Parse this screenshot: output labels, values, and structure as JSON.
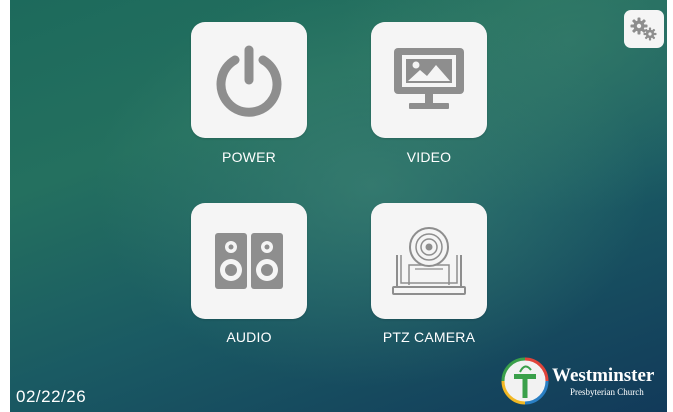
{
  "tiles": [
    {
      "label": "POWER",
      "icon": "power-icon"
    },
    {
      "label": "VIDEO",
      "icon": "monitor-image-icon"
    },
    {
      "label": "AUDIO",
      "icon": "speakers-icon"
    },
    {
      "label": "PTZ CAMERA",
      "icon": "ptz-camera-icon"
    }
  ],
  "settings": {
    "icon": "gears-icon"
  },
  "status": {
    "date": "02/22/26"
  },
  "branding": {
    "name": "Westminster",
    "subtitle": "Presbyterian Church",
    "logo_icon": "westminster-cross-logo-icon"
  },
  "colors": {
    "icon_gray": "#8e8e8e",
    "tile_bg": "#f5f5f5",
    "text": "#ffffff",
    "bg_teal": "#1d6a5c",
    "bg_blue": "#123a5a"
  }
}
